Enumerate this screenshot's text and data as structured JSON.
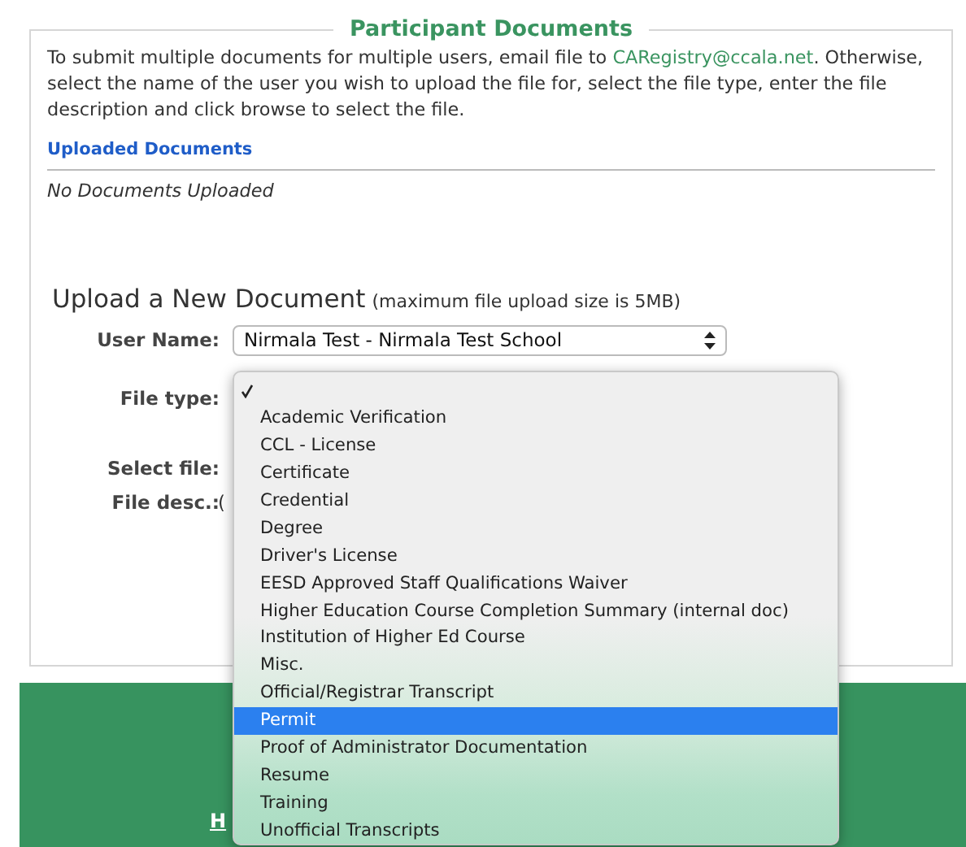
{
  "panel": {
    "title": "Participant Documents",
    "intro": {
      "before": "To submit multiple documents for multiple users, email file to ",
      "link": "CARegistry@ccala.net",
      "after": ". Otherwise, select the name of the user you wish to upload the file for, select the file type, enter the file description and click browse to select the file."
    },
    "uploaded_heading": "Uploaded Documents",
    "uploaded_empty": "No Documents Uploaded",
    "upload_heading": "Upload a New Document",
    "upload_note": "(maximum file upload size is 5MB)",
    "fields": [
      {
        "label": "User Name:",
        "kind": "select",
        "value": "Nirmala Test - Nirmala Test School"
      },
      {
        "label": "File type:",
        "kind": "covered"
      },
      {
        "label": "Select file:",
        "kind": "covered"
      },
      {
        "label": "File desc.:",
        "kind": "partial",
        "value": "("
      }
    ]
  },
  "dropdown": {
    "items": [
      {
        "checked": true,
        "selected": false
      },
      {
        "label": "Academic Verification",
        "checked": false,
        "selected": false
      },
      {
        "label": "CCL - License",
        "checked": false,
        "selected": false
      },
      {
        "label": "Certificate",
        "checked": false,
        "selected": false
      },
      {
        "label": "Credential",
        "checked": false,
        "selected": false
      },
      {
        "label": "Degree",
        "checked": false,
        "selected": false
      },
      {
        "label": "Driver's License",
        "checked": false,
        "selected": false
      },
      {
        "label": "EESD Approved Staff Qualifications Waiver",
        "checked": false,
        "selected": false
      },
      {
        "label": "Higher Education Course Completion Summary (internal doc)",
        "checked": false,
        "selected": false
      },
      {
        "label": "Institution of Higher Ed Course",
        "checked": false,
        "selected": false
      },
      {
        "label": "Misc.",
        "checked": false,
        "selected": false
      },
      {
        "label": "Official/Registrar Transcript",
        "checked": false,
        "selected": false
      },
      {
        "label": "Permit",
        "checked": false,
        "selected": true
      },
      {
        "label": "Proof of Administrator Documentation",
        "checked": false,
        "selected": false
      },
      {
        "label": "Resume",
        "checked": false,
        "selected": false
      },
      {
        "label": "Training",
        "checked": false,
        "selected": false
      },
      {
        "label": "Unofficial Transcripts",
        "checked": false,
        "selected": false
      }
    ]
  },
  "footer": {
    "link": "H"
  }
}
